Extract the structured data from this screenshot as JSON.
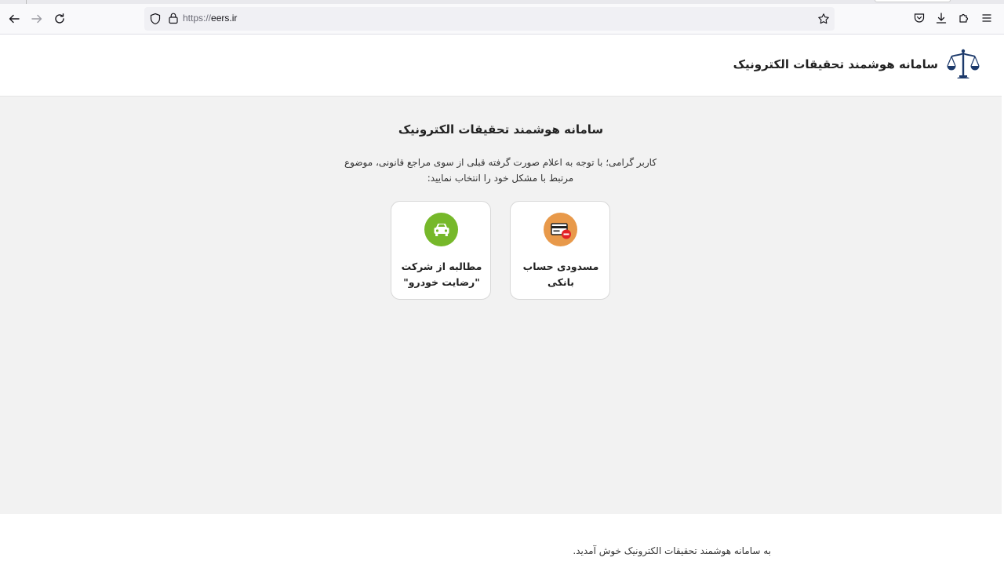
{
  "browser": {
    "url_protocol": "https://",
    "url_host": "eers.ir"
  },
  "header": {
    "brand_title": "سامانه هوشمند تحقیقات الکترونیک"
  },
  "main": {
    "title": "سامانه هوشمند تحقیقات الکترونیک",
    "intro": "کاربر گرامی؛ با توجه به اعلام صورت گرفته قبلی از سوی مراجع قانونی، موضوع مرتبط با مشکل خود را انتخاب نمایید:",
    "cards": [
      {
        "label": "مسدودی حساب بانکی",
        "icon": "blocked-card-icon",
        "color": "#e8994a"
      },
      {
        "label": "مطالبه از شرکت \"رضایت خودرو\"",
        "icon": "car-icon",
        "color": "#76b82a"
      }
    ]
  },
  "footer": {
    "welcome": "به سامانه هوشمند تحقیقات الکترونیک خوش آمدید."
  }
}
